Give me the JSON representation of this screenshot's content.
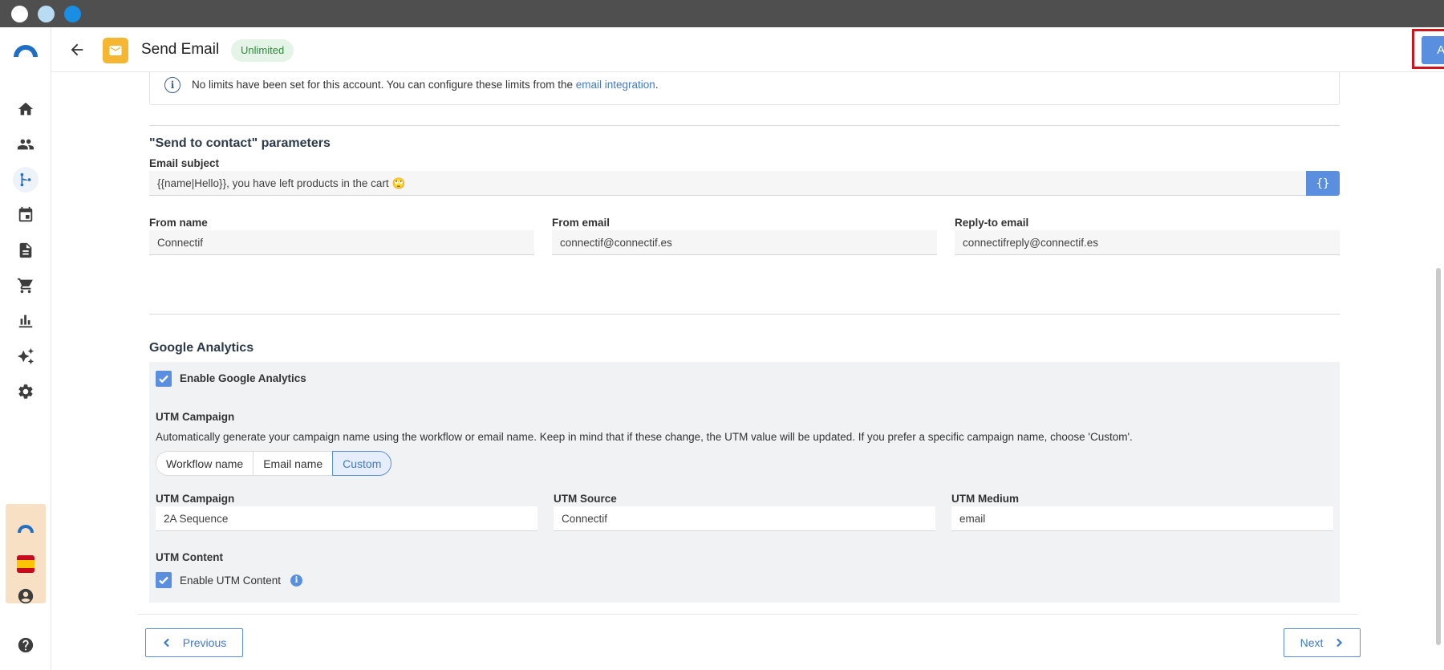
{
  "header": {
    "title": "Send Email",
    "badge": "Unlimited",
    "apply_label": "Apply"
  },
  "sidebar": {
    "items": [
      {
        "icon": "home-icon"
      },
      {
        "icon": "contacts-icon"
      },
      {
        "icon": "workflow-icon",
        "active": true
      },
      {
        "icon": "calendar-icon"
      },
      {
        "icon": "document-icon"
      },
      {
        "icon": "cart-icon"
      },
      {
        "icon": "bar-chart-icon"
      },
      {
        "icon": "sparkles-icon"
      },
      {
        "icon": "gear-icon"
      }
    ],
    "bottom": [
      "account-icon",
      "help-icon"
    ]
  },
  "info": {
    "text": "No limits have been set for this account. You can configure these limits from the ",
    "link": "email integration",
    "suffix": "."
  },
  "send_params": {
    "title": "\"Send to contact\" parameters",
    "subject_label": "Email subject",
    "subject_value": "{{name|Hello}}, you have left products in the cart 🙄",
    "var_button": "{}",
    "from_name_label": "From name",
    "from_name_value": "Connectif",
    "from_email_label": "From email",
    "from_email_value": "connectif@connectif.es",
    "reply_label": "Reply-to email",
    "reply_value": "connectifreply@connectif.es"
  },
  "analytics": {
    "title": "Google Analytics",
    "enable_label": "Enable Google Analytics",
    "enable_checked": true,
    "utm_campaign_heading": "UTM Campaign",
    "utm_description": "Automatically generate your campaign name using the workflow or email name. Keep in mind that if these change, the UTM value will be updated. If you prefer a specific campaign name, choose 'Custom'.",
    "options": [
      "Workflow name",
      "Email name",
      "Custom"
    ],
    "selected_option": "Custom",
    "campaign_label": "UTM Campaign",
    "campaign_value": "2A Sequence",
    "source_label": "UTM Source",
    "source_value": "Connectif",
    "medium_label": "UTM Medium",
    "medium_value": "email",
    "content_heading": "UTM Content",
    "content_enable_label": "Enable UTM Content",
    "content_checked": true
  },
  "footer": {
    "previous_label": "Previous",
    "next_label": "Next"
  },
  "colors": {
    "accent": "#5a8fe0",
    "badge_bg": "#e4f4e6",
    "badge_text": "#2f8a3c",
    "mail_icon": "#f5b731",
    "highlight": "#d0141c"
  }
}
